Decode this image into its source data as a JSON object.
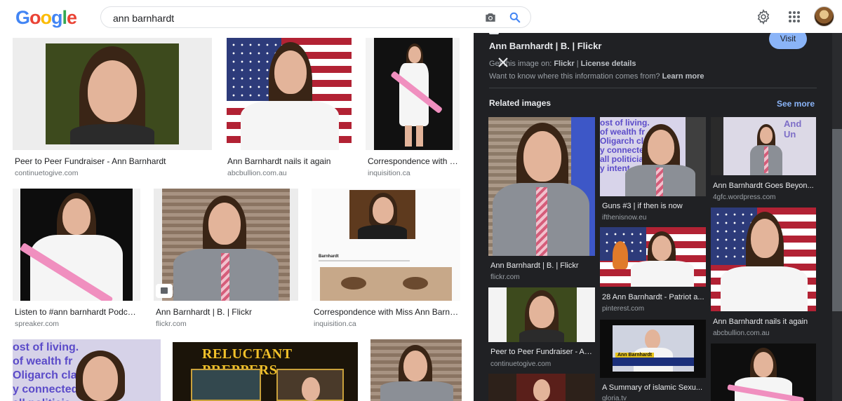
{
  "search": {
    "query": "ann barnhardt"
  },
  "logo": [
    "G",
    "o",
    "o",
    "g",
    "l",
    "e"
  ],
  "logo_colors": [
    "#4285f4",
    "#ea4335",
    "#fbbc05",
    "#4285f4",
    "#34a853",
    "#ea4335"
  ],
  "results": [
    {
      "caption": "Peer to Peer Fundraiser - Ann Barnhardt",
      "source": "continuetogive.com"
    },
    {
      "caption": "Ann Barnhardt nails it again",
      "source": "abcbullion.com.au"
    },
    {
      "caption": "Correspondence with Mi...",
      "source": "inquisition.ca"
    },
    {
      "caption": "Listen to #ann barnhardt Podcast...",
      "source": "spreaker.com"
    },
    {
      "caption": "Ann Barnhardt | B. | Flickr",
      "source": "flickr.com"
    },
    {
      "caption": "Correspondence with Miss Ann Barnhardt",
      "source": "inquisition.ca"
    }
  ],
  "bottom_tiles": {
    "meme_text": "ost of living.\nof wealth fr\nOligarch clas\ny connected\nall politicia",
    "preppers_title": "RELUCTANT PREPPERS"
  },
  "tile_text": {
    "doc_heading": "Barnhardt"
  },
  "panel": {
    "title": "Ann Barnhardt | B. | Flickr",
    "visit_label": "Visit",
    "info_prefix": "Get this image on: ",
    "info_site": "Flickr",
    "info_sep": " | ",
    "info_license": "License details",
    "want_text": "Want to know where this information comes from? ",
    "learn_more": "Learn more",
    "related_title": "Related images",
    "see_more": "See more",
    "related": [
      {
        "caption": "Ann Barnhardt | B. | Flickr",
        "source": "flickr.com"
      },
      {
        "caption": "Guns #3 | if then is now",
        "source": "ifthenisnow.eu"
      },
      {
        "caption": "Ann Barnhardt Goes Beyon...",
        "source": "4gfc.wordpress.com"
      },
      {
        "caption": "28 Ann Barnhardt - Patriot a...",
        "source": "pinterest.com"
      },
      {
        "caption": "Peer to Peer Fundraiser - An...",
        "source": "continuetogive.com"
      },
      {
        "caption": "Ann Barnhardt nails it again",
        "source": "abcbullion.com.au"
      },
      {
        "caption": "A Summary of islamic Sexu...",
        "source": "gloria.tv"
      }
    ],
    "related_meme_text": "ost of living.\nof wealth fr\nOligarch clas\ny connected\nall politicia\ny intent",
    "related_slide_text": "And\nUn",
    "tv_caption": "Ann Barnhardt"
  }
}
